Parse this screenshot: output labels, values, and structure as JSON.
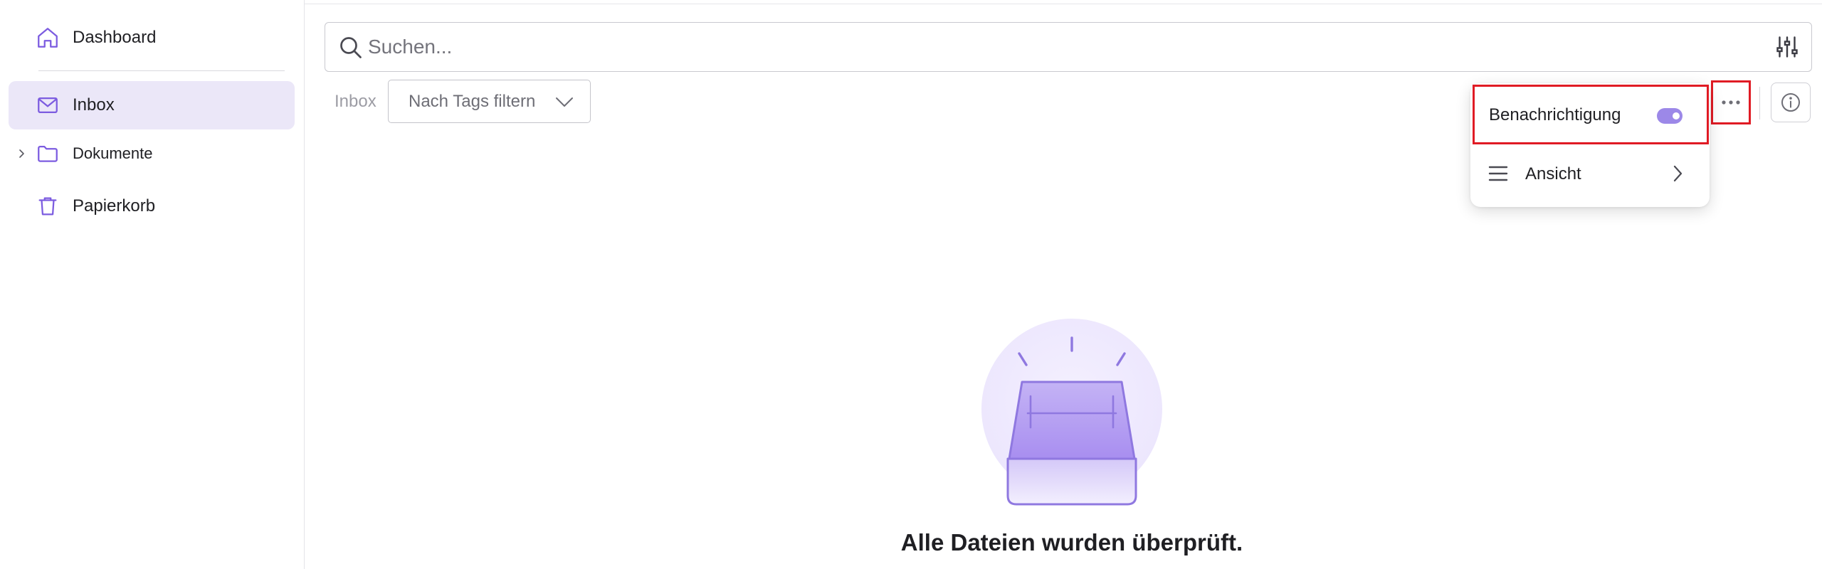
{
  "sidebar": {
    "items": [
      {
        "label": "Dashboard",
        "icon": "home-icon"
      },
      {
        "label": "Inbox",
        "icon": "mail-icon",
        "active": true
      },
      {
        "label": "Dokumente",
        "icon": "folder-icon",
        "expandable": true
      },
      {
        "label": "Papierkorb",
        "icon": "trash-icon"
      }
    ]
  },
  "search": {
    "placeholder": "Suchen...",
    "value": ""
  },
  "toolbar": {
    "breadcrumb": "Inbox",
    "tag_filter_label": "Nach Tags filtern"
  },
  "menu": {
    "notify_label": "Benachrichtigung",
    "notify_enabled": true,
    "view_label": "Ansicht"
  },
  "empty_state": {
    "title": "Alle Dateien wurden überprüft."
  },
  "colors": {
    "accent": "#7c5ce0",
    "accent_light": "#ebe7f8",
    "highlight_red": "#e01b24"
  }
}
